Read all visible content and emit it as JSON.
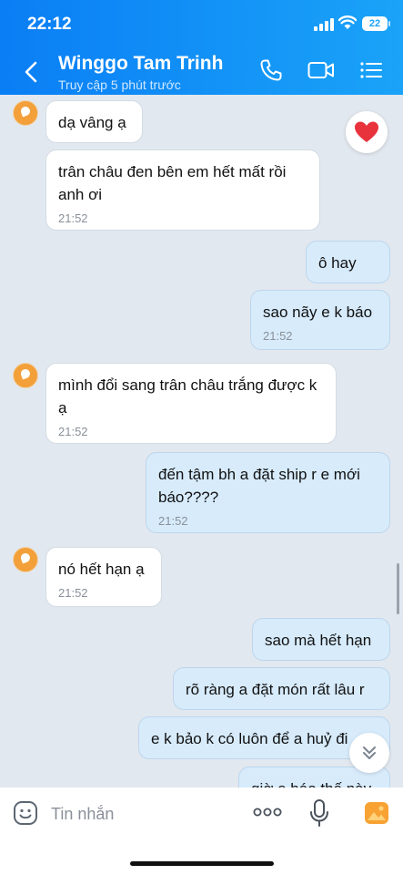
{
  "status_bar": {
    "time": "22:12",
    "battery": "22"
  },
  "header": {
    "title": "Winggo Tam Trinh",
    "subtitle": "Truy cập 5 phút trước"
  },
  "messages": [
    {
      "text": "dạ vâng ạ"
    },
    {
      "text": "trân châu đen bên em hết mất rồi anh ơi",
      "time": "21:52"
    },
    {
      "text": "ô hay"
    },
    {
      "text": "sao nãy e k báo",
      "time": "21:52"
    },
    {
      "text": "mình đổi sang trân châu trắng được k ạ",
      "time": "21:52"
    },
    {
      "text": "đến tậm bh a đặt ship r e mới báo????",
      "time": "21:52"
    },
    {
      "text": "nó hết hạn ạ",
      "time": "21:52"
    },
    {
      "text": "sao mà hết hạn"
    },
    {
      "text": "rõ ràng a đặt món rất lâu r"
    },
    {
      "text": "e k bảo k có luôn để a huỷ đi"
    },
    {
      "text": "giờ e báo thế này"
    }
  ],
  "reaction": {
    "icon": "heart-icon",
    "color": "#e8323c"
  },
  "input": {
    "placeholder": "Tin nhắn"
  },
  "colors": {
    "header_start": "#0a7ef5",
    "header_end": "#1aa3f8",
    "outgoing_bubble": "#d7ebfb",
    "background": "#e2e8ef"
  }
}
